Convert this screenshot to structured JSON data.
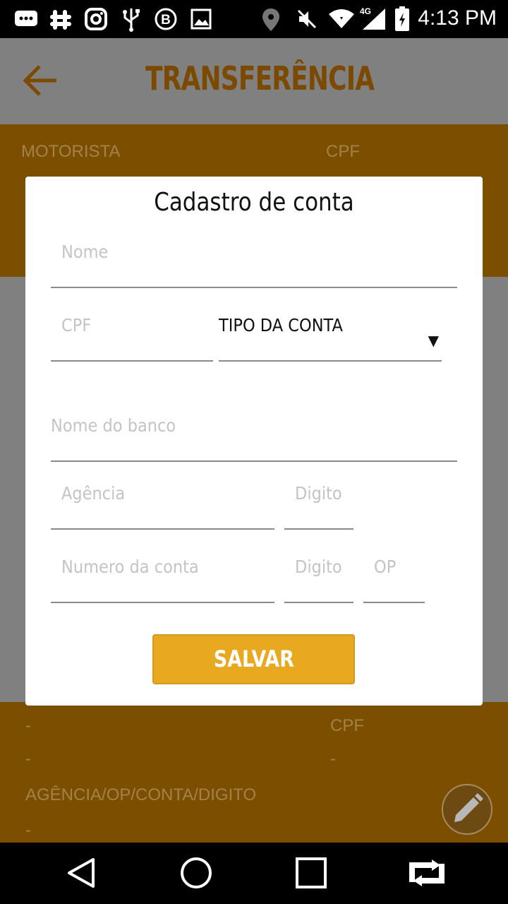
{
  "status_bar": {
    "time": "4:13 PM",
    "network": "4G",
    "icons": [
      "message-icon",
      "slack-icon",
      "instagram-icon",
      "usb-icon",
      "b-icon",
      "image-icon",
      "location-icon",
      "mute-icon",
      "wifi-icon",
      "signal-icon",
      "battery-icon"
    ]
  },
  "app_bar": {
    "title": "TRANSFERÊNCIA",
    "back_icon": "arrow-left-icon"
  },
  "top_band": {
    "motorista_label": "MOTORISTA",
    "cpf_label": "CPF"
  },
  "bottom_band": {
    "dash_1": "-",
    "dash_2": "-",
    "cpf_label": "CPF",
    "cpf_value": "-",
    "account_label": "AGÊNCIA/OP/CONTA/DIGITO",
    "account_value": "-"
  },
  "fab_icon": "pencil-icon",
  "dialog": {
    "title": "Cadastro de conta",
    "fields": {
      "nome": "Nome",
      "cpf": "CPF",
      "tipo_conta": "TIPO DA CONTA",
      "nome_banco": "Nome do banco",
      "agencia": "Agência",
      "digito_agencia": "Digito",
      "numero_conta": "Numero da conta",
      "digito_conta": "Digito",
      "op": "OP"
    },
    "save_label": "SALVAR"
  },
  "nav_bar": [
    "back-triangle-icon",
    "home-circle-icon",
    "recents-square-icon",
    "switch-app-icon"
  ],
  "colors": {
    "accent": "#e8a820",
    "band": "#7c4e00",
    "title": "#7c4900",
    "overlay": "#808080"
  }
}
